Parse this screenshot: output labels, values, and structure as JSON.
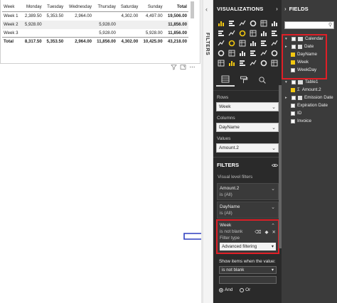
{
  "matrix": {
    "columns": [
      "Week",
      "Monday",
      "Tuesday",
      "Wednesday",
      "Thursday",
      "Saturday",
      "Sunday",
      "Total"
    ],
    "rows": [
      {
        "label": "Week 1",
        "cells": [
          "2,389.50",
          "5,353.50",
          "2,964.00",
          "",
          "4,302.00",
          "4,497.00",
          "19,506.00"
        ]
      },
      {
        "label": "Week 2",
        "cells": [
          "5,928.00",
          "",
          "",
          "5,928.00",
          "",
          "",
          "11,856.00"
        ]
      },
      {
        "label": "Week 3",
        "cells": [
          "",
          "",
          "",
          "5,928.00",
          "",
          "5,928.00",
          "11,856.00"
        ]
      }
    ],
    "total": {
      "label": "Total",
      "cells": [
        "8,317.50",
        "5,353.50",
        "2,964.00",
        "11,856.00",
        "4,302.00",
        "10,425.00",
        "43,218.00"
      ]
    }
  },
  "strip": {
    "label": "FILTERS"
  },
  "viz": {
    "title": "VISUALIZATIONS",
    "rows_label": "Rows",
    "rows_value": "Week",
    "columns_label": "Columns",
    "columns_value": "DayName",
    "values_label": "Values",
    "values_value": "Amount.2",
    "filters_title": "FILTERS",
    "visual_level": "Visual level filters",
    "filters": [
      {
        "title": "Amount.2",
        "sub": "is (All)"
      },
      {
        "title": "DayName",
        "sub": "is (All)"
      }
    ],
    "week_filter": {
      "title": "Week",
      "sub": "is not blank",
      "type_label": "Filter type",
      "type_value": "Advanced filtering"
    },
    "show_items": "Show items when the value:",
    "condition": "is not blank",
    "and_label": "And",
    "or_label": "Or",
    "icon_colors": [
      "#f2c811",
      "#e8e8e8",
      "#e8e8e8",
      "#e8e8e8",
      "#e8e8e8",
      "#e8e8e8",
      "#e8e8e8",
      "#e8e8e8",
      "#f2c811",
      "#e8e8e8",
      "#e8e8e8",
      "#e8e8e8",
      "#e8e8e8",
      "#f2c811",
      "#e8e8e8",
      "#e8e8e8",
      "#e8e8e8",
      "#e8e8e8",
      "#e8e8e8",
      "#e8e8e8",
      "#e8e8e8",
      "#e8e8e8",
      "#e8e8e8",
      "#e8e8e8",
      "#e8e8e8",
      "#f2c811",
      "#e8e8e8",
      "#e8e8e8",
      "#e8e8e8",
      "#e8e8e8"
    ]
  },
  "fields": {
    "title": "FIELDS",
    "tables": [
      {
        "name": "Calendar",
        "items": [
          "Date",
          "DayName",
          "Week",
          "WeekDay"
        ],
        "checked": [
          false,
          true,
          true,
          false
        ]
      },
      {
        "name": "Table1",
        "items": [
          "Amount.2",
          "Emission Date",
          "Expiration Date",
          "ID",
          "Invoice"
        ],
        "checked": [
          true,
          false,
          false,
          false,
          false
        ]
      }
    ]
  },
  "colors": {
    "accent": "#f2c811",
    "highlight": "#e01f27",
    "arrow": "#2f3fbf"
  }
}
